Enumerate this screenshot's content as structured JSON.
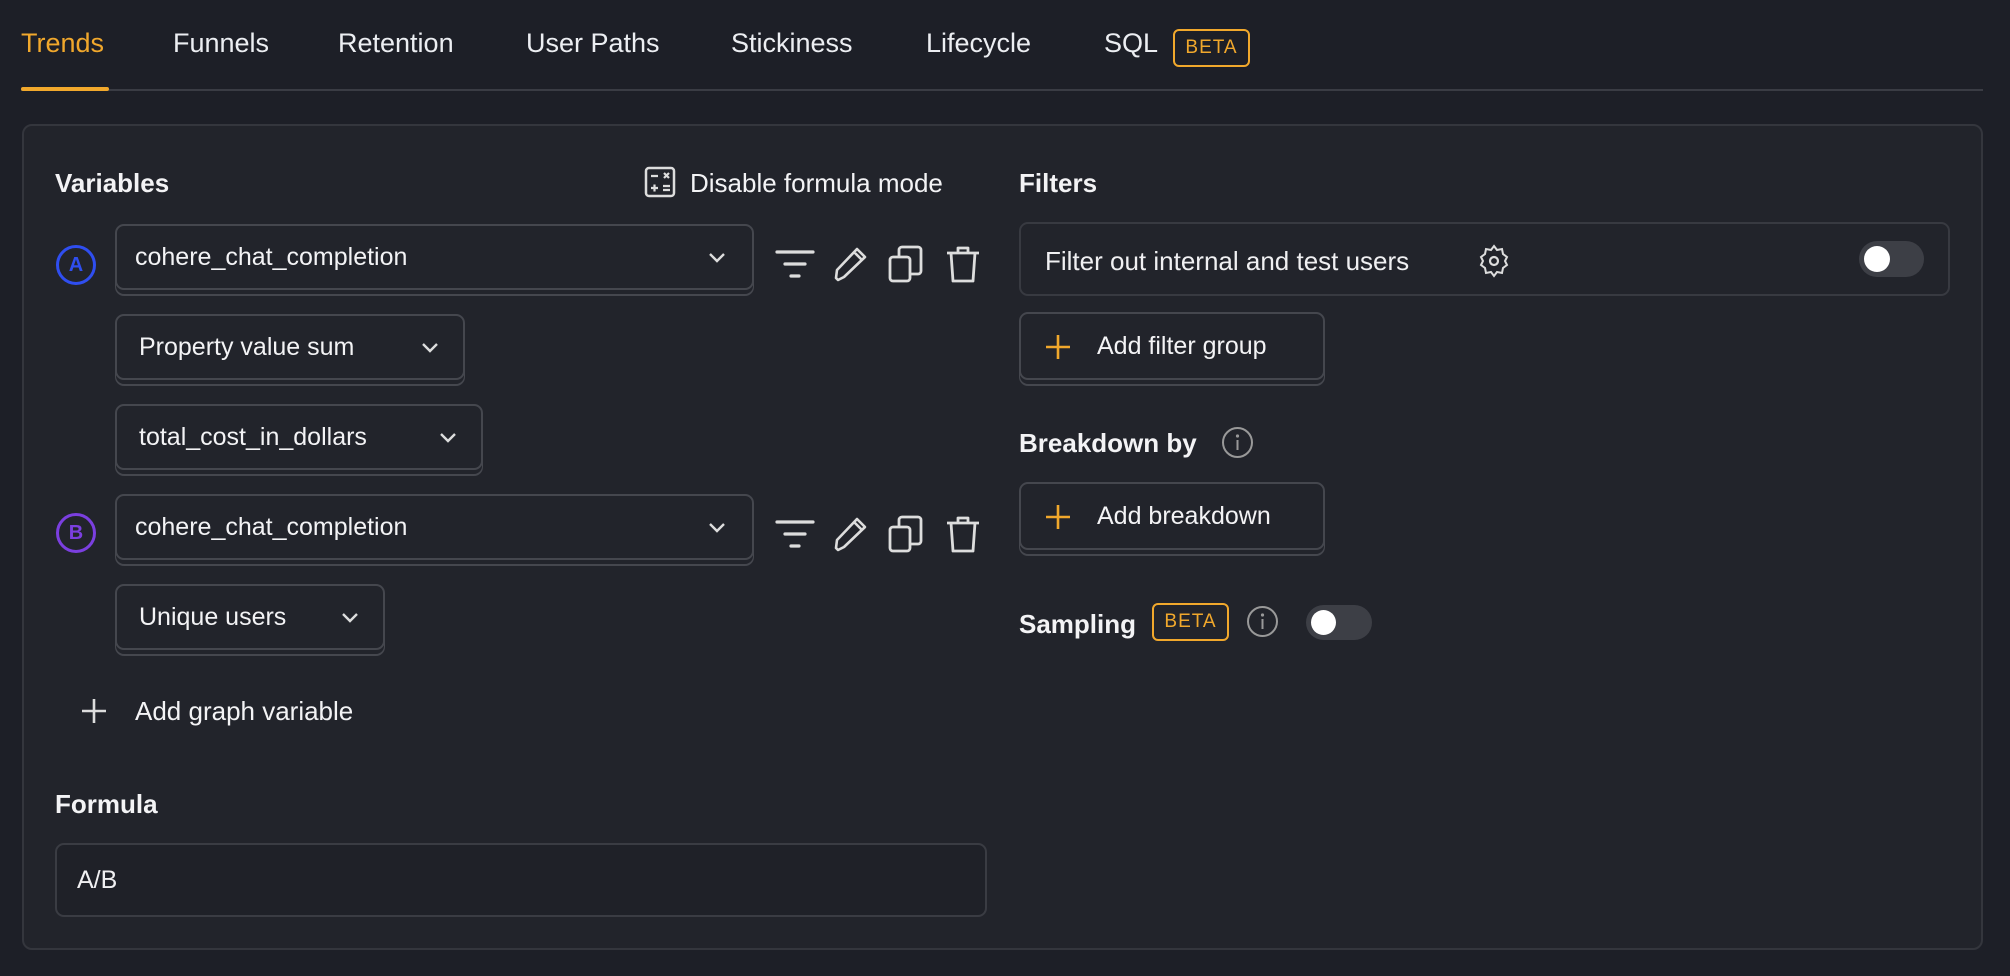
{
  "tabs": [
    {
      "label": "Trends",
      "active": true
    },
    {
      "label": "Funnels"
    },
    {
      "label": "Retention"
    },
    {
      "label": "User Paths"
    },
    {
      "label": "Stickiness"
    },
    {
      "label": "Lifecycle"
    },
    {
      "label": "SQL",
      "badge": "BETA"
    }
  ],
  "accent_color": "#f1a82c",
  "variables": {
    "title": "Variables",
    "formula_toggle_label": "Disable formula mode",
    "series": [
      {
        "letter": "A",
        "color": "#2f4ef0",
        "event": "cohere_chat_completion",
        "math": "Property value sum",
        "property": "total_cost_in_dollars"
      },
      {
        "letter": "B",
        "color": "#7b3fe0",
        "event": "cohere_chat_completion",
        "math": "Unique users"
      }
    ],
    "add_label": "Add graph variable"
  },
  "formula": {
    "title": "Formula",
    "value": "A/B"
  },
  "filters": {
    "title": "Filters",
    "internal_users_label": "Filter out internal and test users",
    "internal_users_enabled": false,
    "add_group_label": "Add filter group"
  },
  "breakdown": {
    "title": "Breakdown by",
    "add_label": "Add breakdown"
  },
  "sampling": {
    "title": "Sampling",
    "badge": "BETA",
    "enabled": false
  }
}
